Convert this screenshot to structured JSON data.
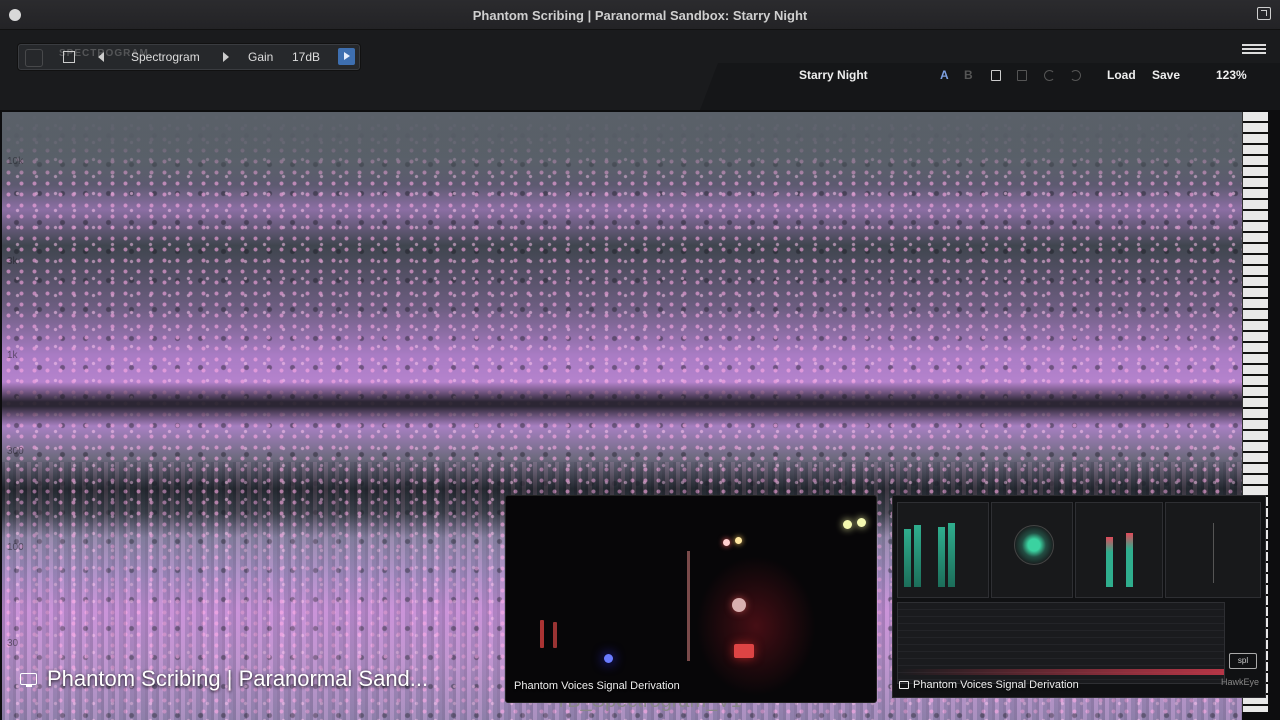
{
  "window": {
    "title": "Phantom Scribing | Paranormal Sandbox: Starry Night"
  },
  "plugin": {
    "logo_text": "SPECTROGRAM",
    "view_label": "Spectrogram",
    "gain_label": "Gain",
    "gain_value": "17dB",
    "preset_name": "Starry Night",
    "ab_a": "A",
    "ab_b": "B",
    "load_label": "Load",
    "save_label": "Save",
    "zoom": "123%"
  },
  "spectrogram": {
    "freq_labels": [
      "10k",
      "3k",
      "1k",
      "300",
      "100",
      "30"
    ]
  },
  "captions": {
    "main": "Phantom Scribing | Paranormal Sand...",
    "underlay": "TB_Spectrogram_V1",
    "camera": "Phantom Voices Signal Derivation",
    "meters": "Phantom Voices Signal Derivation",
    "meters_logo": "spl",
    "meters_brand": "HawkEye"
  }
}
